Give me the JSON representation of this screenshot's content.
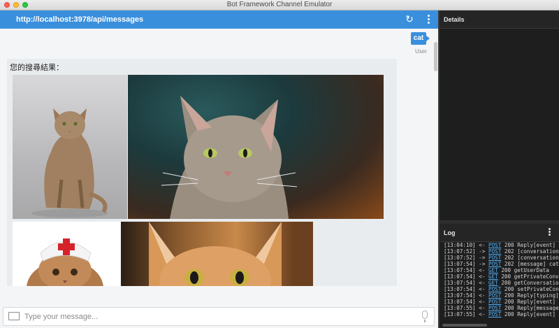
{
  "window": {
    "title": "Bot Framework Channel Emulator"
  },
  "address_bar": {
    "endpoint": "http://localhost:3978/api/messages"
  },
  "conversation": {
    "user_message": {
      "text": "cat",
      "sender": "User"
    },
    "bot_message": {
      "text": "您的搜尋結果：",
      "attachments": [
        "cat-photo",
        "cat-photo",
        "cat-photo",
        "cat-photo"
      ]
    }
  },
  "composer": {
    "placeholder": "Type your message..."
  },
  "details_panel": {
    "title": "Details"
  },
  "log_panel": {
    "title": "Log",
    "entries": [
      {
        "time": "[13:04:10]",
        "dir": "<-",
        "verb": "POST",
        "status": "200",
        "text": "Reply[event]"
      },
      {
        "time": "[13:07:52]",
        "dir": "->",
        "verb": "POST",
        "status": "202",
        "text": "[conversationUpdate]"
      },
      {
        "time": "[13:07:52]",
        "dir": "->",
        "verb": "POST",
        "status": "202",
        "text": "[conversationUpdate]"
      },
      {
        "time": "[13:07:54]",
        "dir": "->",
        "verb": "POST",
        "status": "202",
        "text": "[message] cat"
      },
      {
        "time": "[13:07:54]",
        "dir": "<-",
        "verb": "GET",
        "status": "200",
        "text": "getUserData"
      },
      {
        "time": "[13:07:54]",
        "dir": "<-",
        "verb": "GET",
        "status": "200",
        "text": "getPrivateConversationData"
      },
      {
        "time": "[13:07:54]",
        "dir": "<-",
        "verb": "GET",
        "status": "200",
        "text": "getConversationData"
      },
      {
        "time": "[13:07:54]",
        "dir": "<-",
        "verb": "POST",
        "status": "200",
        "text": "setPrivateConversationData"
      },
      {
        "time": "[13:07:54]",
        "dir": "<-",
        "verb": "POST",
        "status": "200",
        "text": "Reply[typing]"
      },
      {
        "time": "[13:07:54]",
        "dir": "<-",
        "verb": "POST",
        "status": "200",
        "text": "Reply[event]"
      },
      {
        "time": "[13:07:55]",
        "dir": "<-",
        "verb": "POST",
        "status": "200",
        "text": "Reply[message]"
      },
      {
        "time": "[13:07:55]",
        "dir": "<-",
        "verb": "POST",
        "status": "200",
        "text": "Reply[event]"
      }
    ]
  },
  "colors": {
    "accent": "#3a8fdc",
    "log_link": "#4fb3ff",
    "panel_bg": "#1e1e1e"
  },
  "icons": {
    "refresh": "refresh-icon",
    "menu": "more-vertical-icon",
    "attach": "image-icon",
    "mic": "microphone-icon"
  }
}
